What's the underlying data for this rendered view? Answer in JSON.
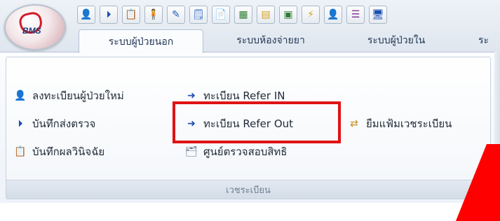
{
  "app": {
    "logo_text": "BMS"
  },
  "tabs": [
    {
      "label": "ระบบผู้ป่วยนอก",
      "active": true
    },
    {
      "label": "ระบบห้องจ่ายยา",
      "active": false
    },
    {
      "label": "ระบบผู้ป่วยใน",
      "active": false
    },
    {
      "label": "ระ",
      "active": false
    }
  ],
  "ribbon": {
    "group_title": "เวชระเบียน",
    "commands": {
      "add_patient": "ลงทะเบียนผู้ป่วยใหม่",
      "refer_in": "ทะเบียน Refer IN",
      "send_exam": "บันทึกส่งตรวจ",
      "refer_out": "ทะเบียน Refer Out",
      "borrow_records": "ยืมแฟ้มเวชระเบียน",
      "diagnosis": "บันทึกผลวินิจฉัย",
      "rights_check": "ศูนย์ตรวจสอบสิทธิ"
    }
  },
  "colors": {
    "highlight": "#e01214",
    "red_shape": "#ff0000"
  }
}
